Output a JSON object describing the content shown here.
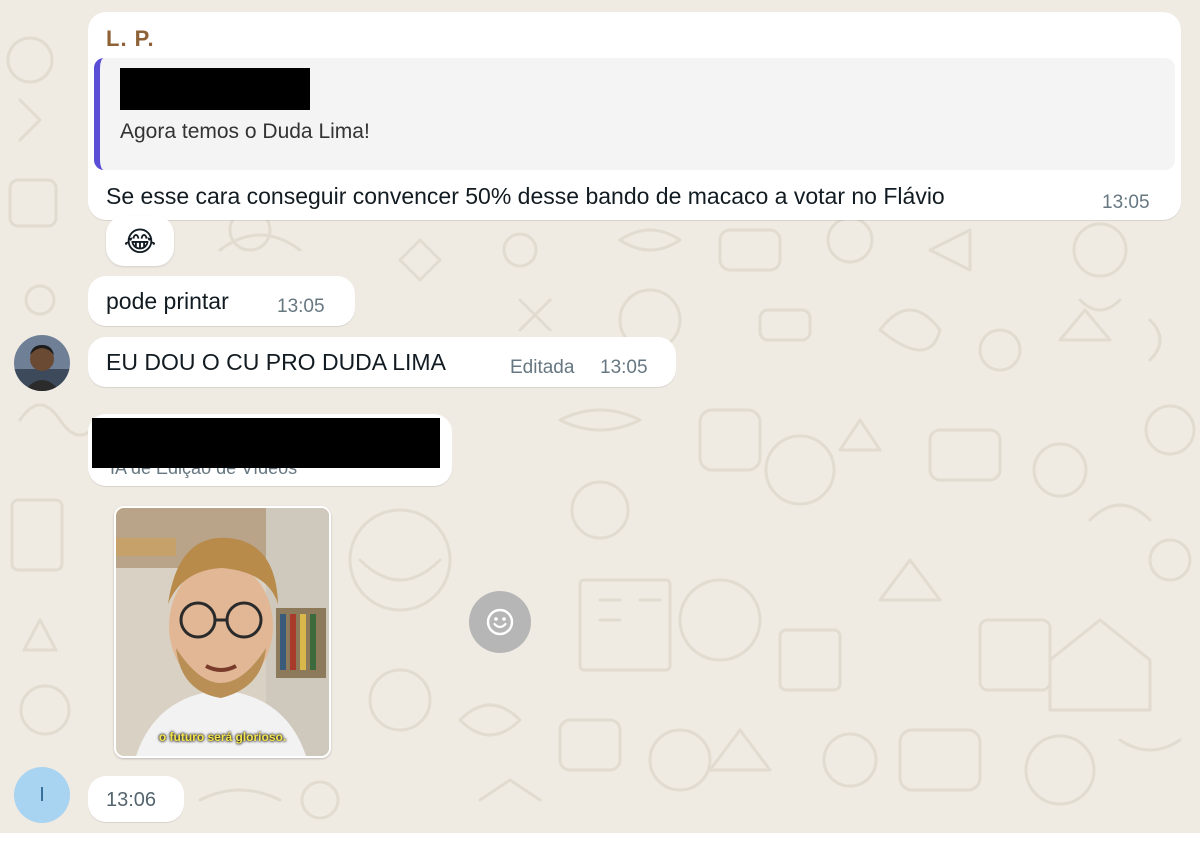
{
  "messages": {
    "quoted": {
      "sender": "L. P.",
      "quote_text": "Agora temos o Duda Lima!",
      "text": "Se esse cara conseguir convencer 50% desse bando de macaco a votar no Flávio",
      "time": "13:05",
      "reaction": "😂"
    },
    "printar": {
      "text": "pode printar",
      "time": "13:05"
    },
    "duda": {
      "text": "EU DOU O CU PRO DUDA LIMA",
      "edited": "Editada",
      "time": "13:05"
    },
    "link": {
      "subtitle": "IA de Edição de Vídeos"
    },
    "video": {
      "caption": "o futuro será glorioso."
    },
    "last": {
      "time": "13:06",
      "avatar_initial": "I"
    }
  },
  "icons": {
    "reaction_button": "smiley-icon"
  },
  "colors": {
    "background": "#efeae2",
    "bubble": "#ffffff",
    "sender_name": "#8e6236",
    "quote_bar": "#5a4dd6",
    "avatar_initial_bg": "#a8d4f2"
  }
}
